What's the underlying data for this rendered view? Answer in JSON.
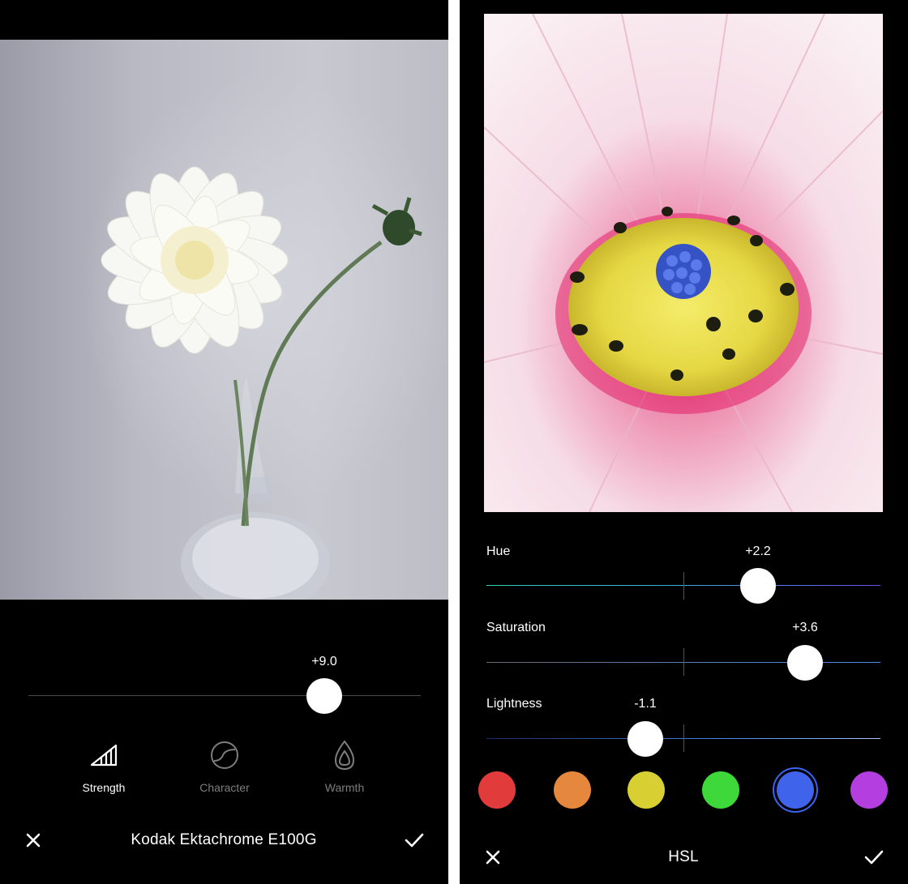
{
  "left": {
    "strength_value": "+9.0",
    "slider_value_fraction": 0.75,
    "tools": [
      {
        "label": "Strength",
        "icon": "strength-icon",
        "active": true
      },
      {
        "label": "Character",
        "icon": "character-icon",
        "active": false
      },
      {
        "label": "Warmth",
        "icon": "warmth-icon",
        "active": false
      }
    ],
    "preset_title": "Kodak Ektachrome E100G",
    "cancel_icon": "close-icon",
    "confirm_icon": "checkmark-icon"
  },
  "right": {
    "sliders": [
      {
        "label": "Hue",
        "value": "+2.2"
      },
      {
        "label": "Saturation",
        "value": "+3.6"
      },
      {
        "label": "Lightness",
        "value": "-1.1"
      }
    ],
    "swatches": [
      {
        "color": "#e23b3b",
        "name": "red"
      },
      {
        "color": "#e5873c",
        "name": "orange"
      },
      {
        "color": "#d8d032",
        "name": "yellow"
      },
      {
        "color": "#3ed83b",
        "name": "green"
      },
      {
        "color": "#3f63ea",
        "name": "blue",
        "selected": true
      },
      {
        "color": "#b43ee0",
        "name": "purple"
      }
    ],
    "title": "HSL",
    "cancel_icon": "close-icon",
    "confirm_icon": "checkmark-icon"
  }
}
